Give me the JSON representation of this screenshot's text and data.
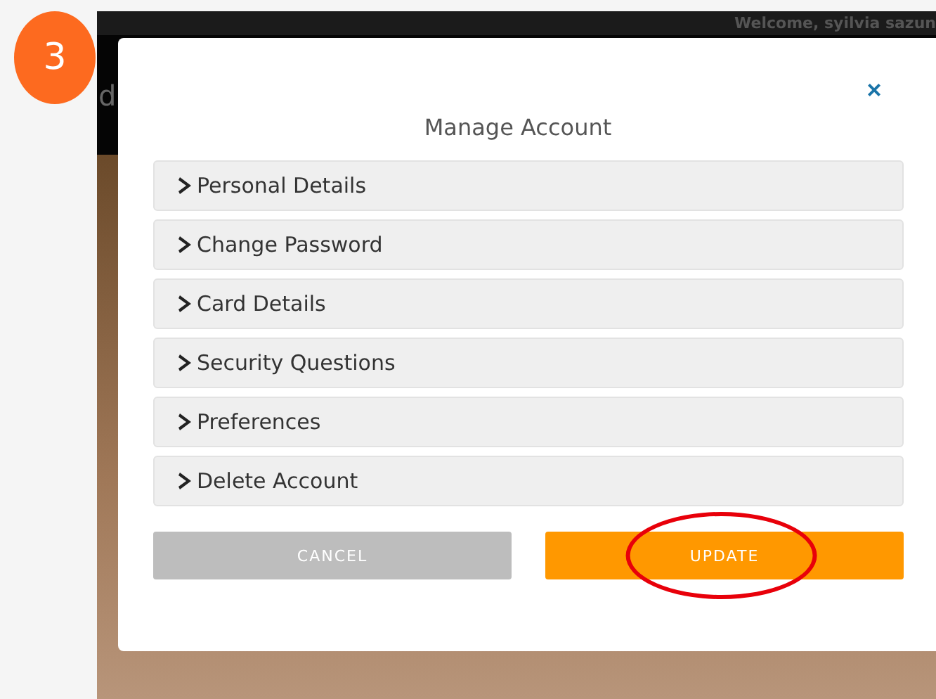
{
  "step_badge": "3",
  "site": {
    "welcome": "Welcome, syilvia sazun",
    "logo_fragment": "d"
  },
  "modal": {
    "title": "Manage Account",
    "close": "×",
    "sections": [
      {
        "label": "Personal Details",
        "expanded": false
      },
      {
        "label": "Change Password",
        "expanded": false
      },
      {
        "label": "Card Details",
        "expanded": false
      },
      {
        "label": "Security Questions",
        "expanded": false
      },
      {
        "label": "Preferences",
        "expanded": false
      },
      {
        "label": "Delete Account",
        "expanded": false
      }
    ],
    "buttons": [
      {
        "label": "CANCEL",
        "kind": "secondary",
        "highlighted": false
      },
      {
        "label": "UPDATE",
        "kind": "primary",
        "highlighted": true
      }
    ]
  }
}
